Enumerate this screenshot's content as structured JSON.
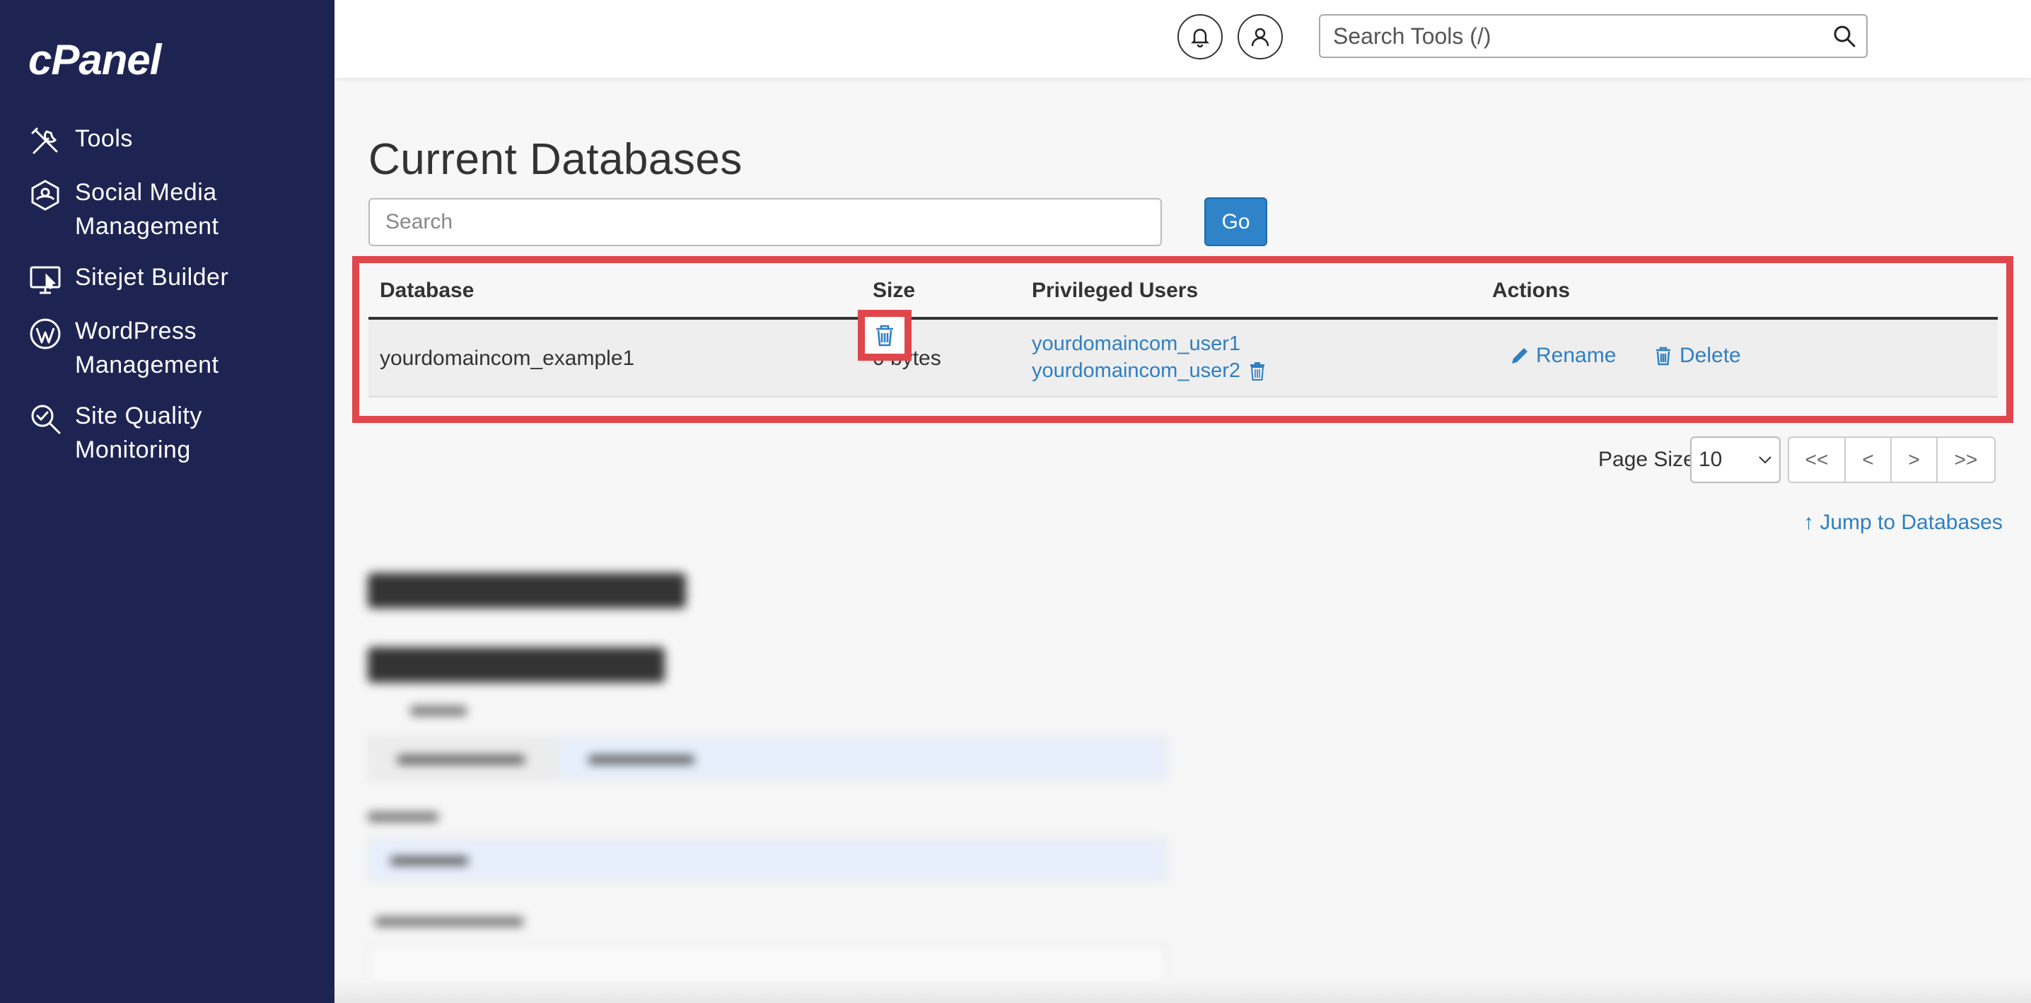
{
  "sidebar": {
    "logo": "cPanel",
    "items": [
      {
        "label": "Tools",
        "icon": "tools-icon"
      },
      {
        "label": "Social Media\nManagement",
        "icon": "social-media-icon"
      },
      {
        "label": "Sitejet Builder",
        "icon": "sitejet-icon"
      },
      {
        "label": "WordPress\nManagement",
        "icon": "wordpress-icon"
      },
      {
        "label": "Site Quality\nMonitoring",
        "icon": "site-quality-icon"
      }
    ]
  },
  "header": {
    "search_placeholder": "Search Tools (/)"
  },
  "main": {
    "title": "Current Databases",
    "search_placeholder": "Search",
    "go_label": "Go",
    "table": {
      "headers": [
        "Database",
        "Size",
        "Privileged Users",
        "Actions"
      ],
      "rows": [
        {
          "database": "yourdomaincom_example1",
          "size": "0 bytes",
          "users": [
            "yourdomaincom_user1",
            "yourdomaincom_user2"
          ],
          "actions": {
            "rename": "Rename",
            "delete": "Delete"
          }
        }
      ]
    },
    "pagination": {
      "page_size_label": "Page Size",
      "page_size_value": "10",
      "first": "<<",
      "prev": "<",
      "next": ">",
      "last": ">>"
    },
    "jump_link": "Jump to Databases"
  },
  "colors": {
    "sidebar_bg": "#1e2452",
    "accent_blue": "#2f83c9",
    "highlight_red": "#e0474c"
  }
}
